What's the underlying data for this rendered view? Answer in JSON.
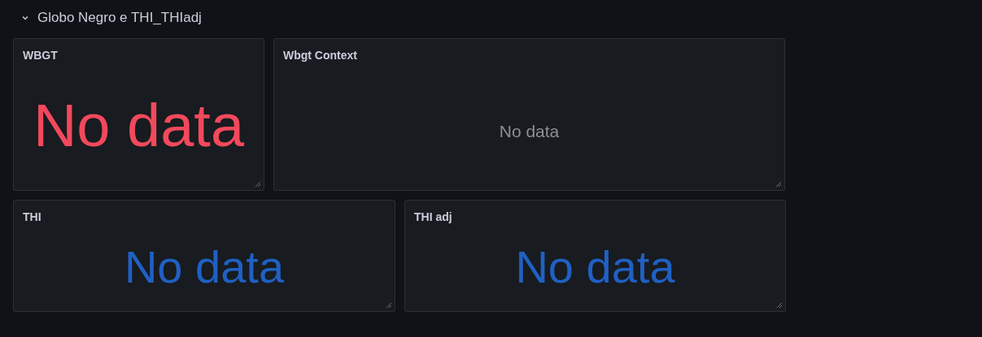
{
  "row": {
    "title": "Globo Negro e THI_THIadj",
    "expanded": true
  },
  "panel_rows": [
    {
      "panels": [
        {
          "title": "WBGT",
          "kind": "stat",
          "message": "No data",
          "color": "#f2495c"
        },
        {
          "title": "Wbgt Context",
          "kind": "text",
          "message": "No data"
        }
      ]
    },
    {
      "panels": [
        {
          "title": "THI",
          "kind": "stat",
          "message": "No data",
          "color": "#1f60c4"
        },
        {
          "title": "THI adj",
          "kind": "stat",
          "message": "No data",
          "color": "#1f60c4"
        }
      ]
    }
  ]
}
